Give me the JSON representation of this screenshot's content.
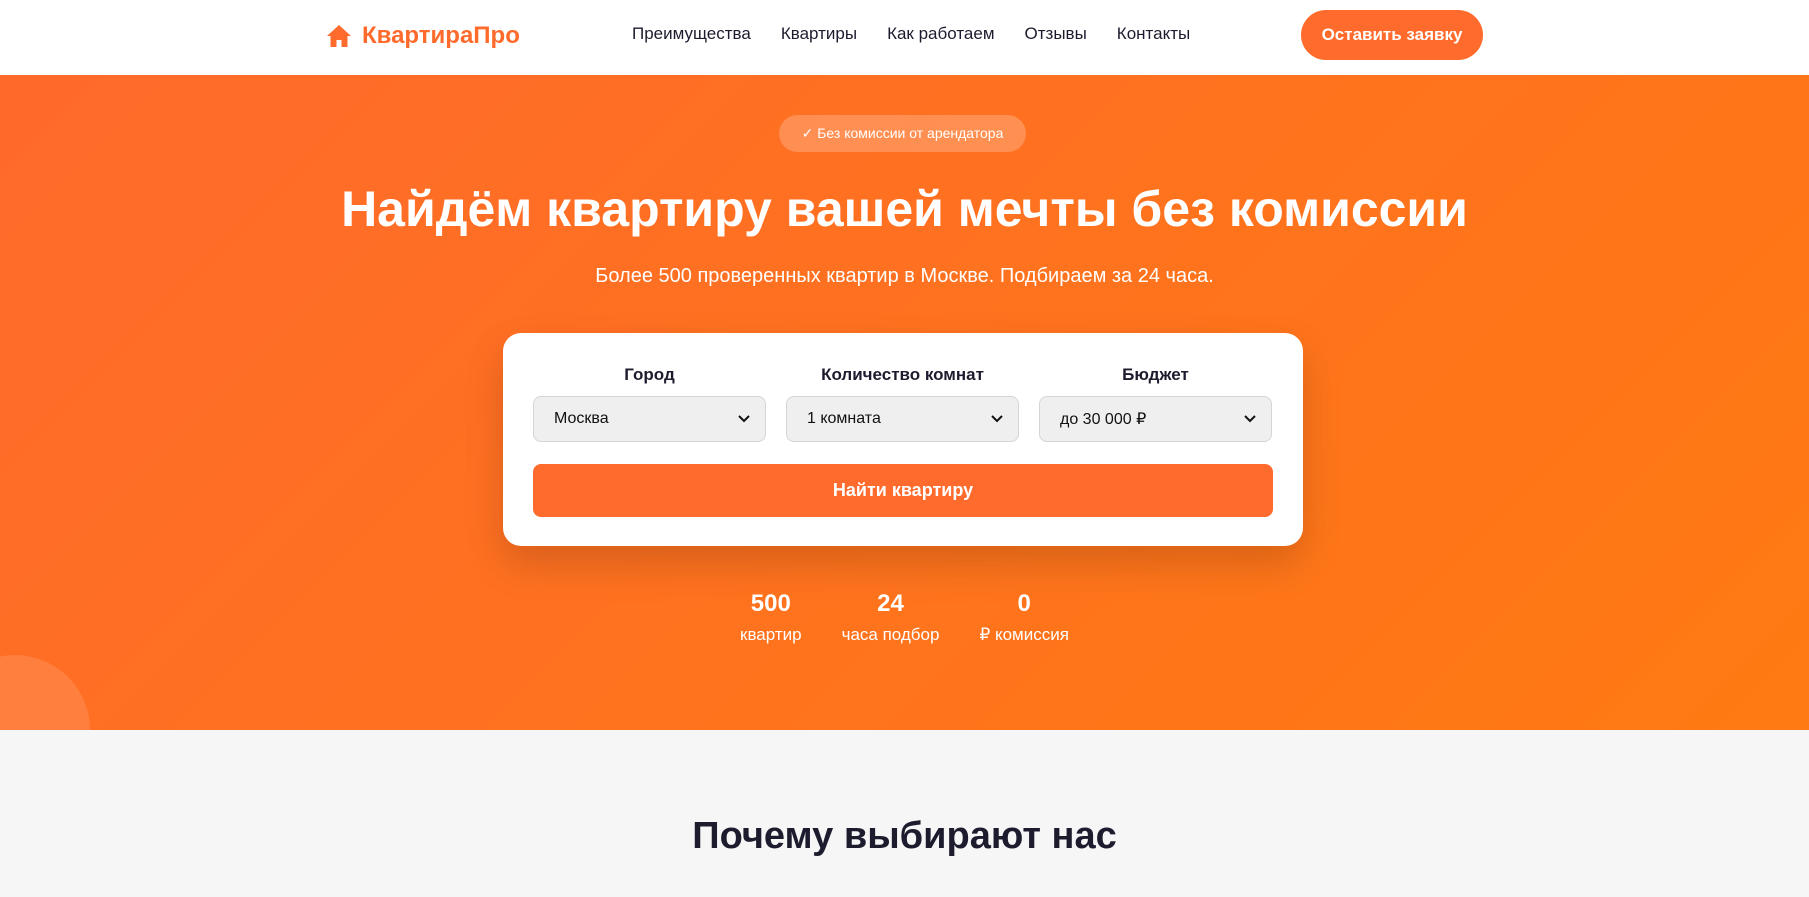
{
  "header": {
    "logo_text": "КвартираПро",
    "logo_icon": "house-icon",
    "nav": [
      "Преимущества",
      "Квартиры",
      "Как работаем",
      "Отзывы",
      "Контакты"
    ],
    "cta_label": "Оставить заявку"
  },
  "colors": {
    "accent": "#ff6b2c",
    "hero_gradient_start": "#ff6a2b",
    "hero_gradient_end": "#ff7a12",
    "text_dark": "#1c1c2e"
  },
  "hero": {
    "badge": "✓ Без комиссии от арендатора",
    "title": "Найдём квартиру вашей мечты без комиссии",
    "subtitle": "Более 500 проверенных квартир в Москве. Подбираем за 24 часа."
  },
  "search": {
    "fields": [
      {
        "label": "Город",
        "value": "Москва"
      },
      {
        "label": "Количество комнат",
        "value": "1 комната"
      },
      {
        "label": "Бюджет",
        "value": "до 30 000 ₽"
      }
    ],
    "button_label": "Найти квартиру"
  },
  "stats": [
    {
      "value": "500",
      "label": "квартир"
    },
    {
      "value": "24",
      "label": "часа подбор"
    },
    {
      "value": "0",
      "label": "₽ комиссия"
    }
  ],
  "section": {
    "title": "Почему выбирают нас"
  }
}
